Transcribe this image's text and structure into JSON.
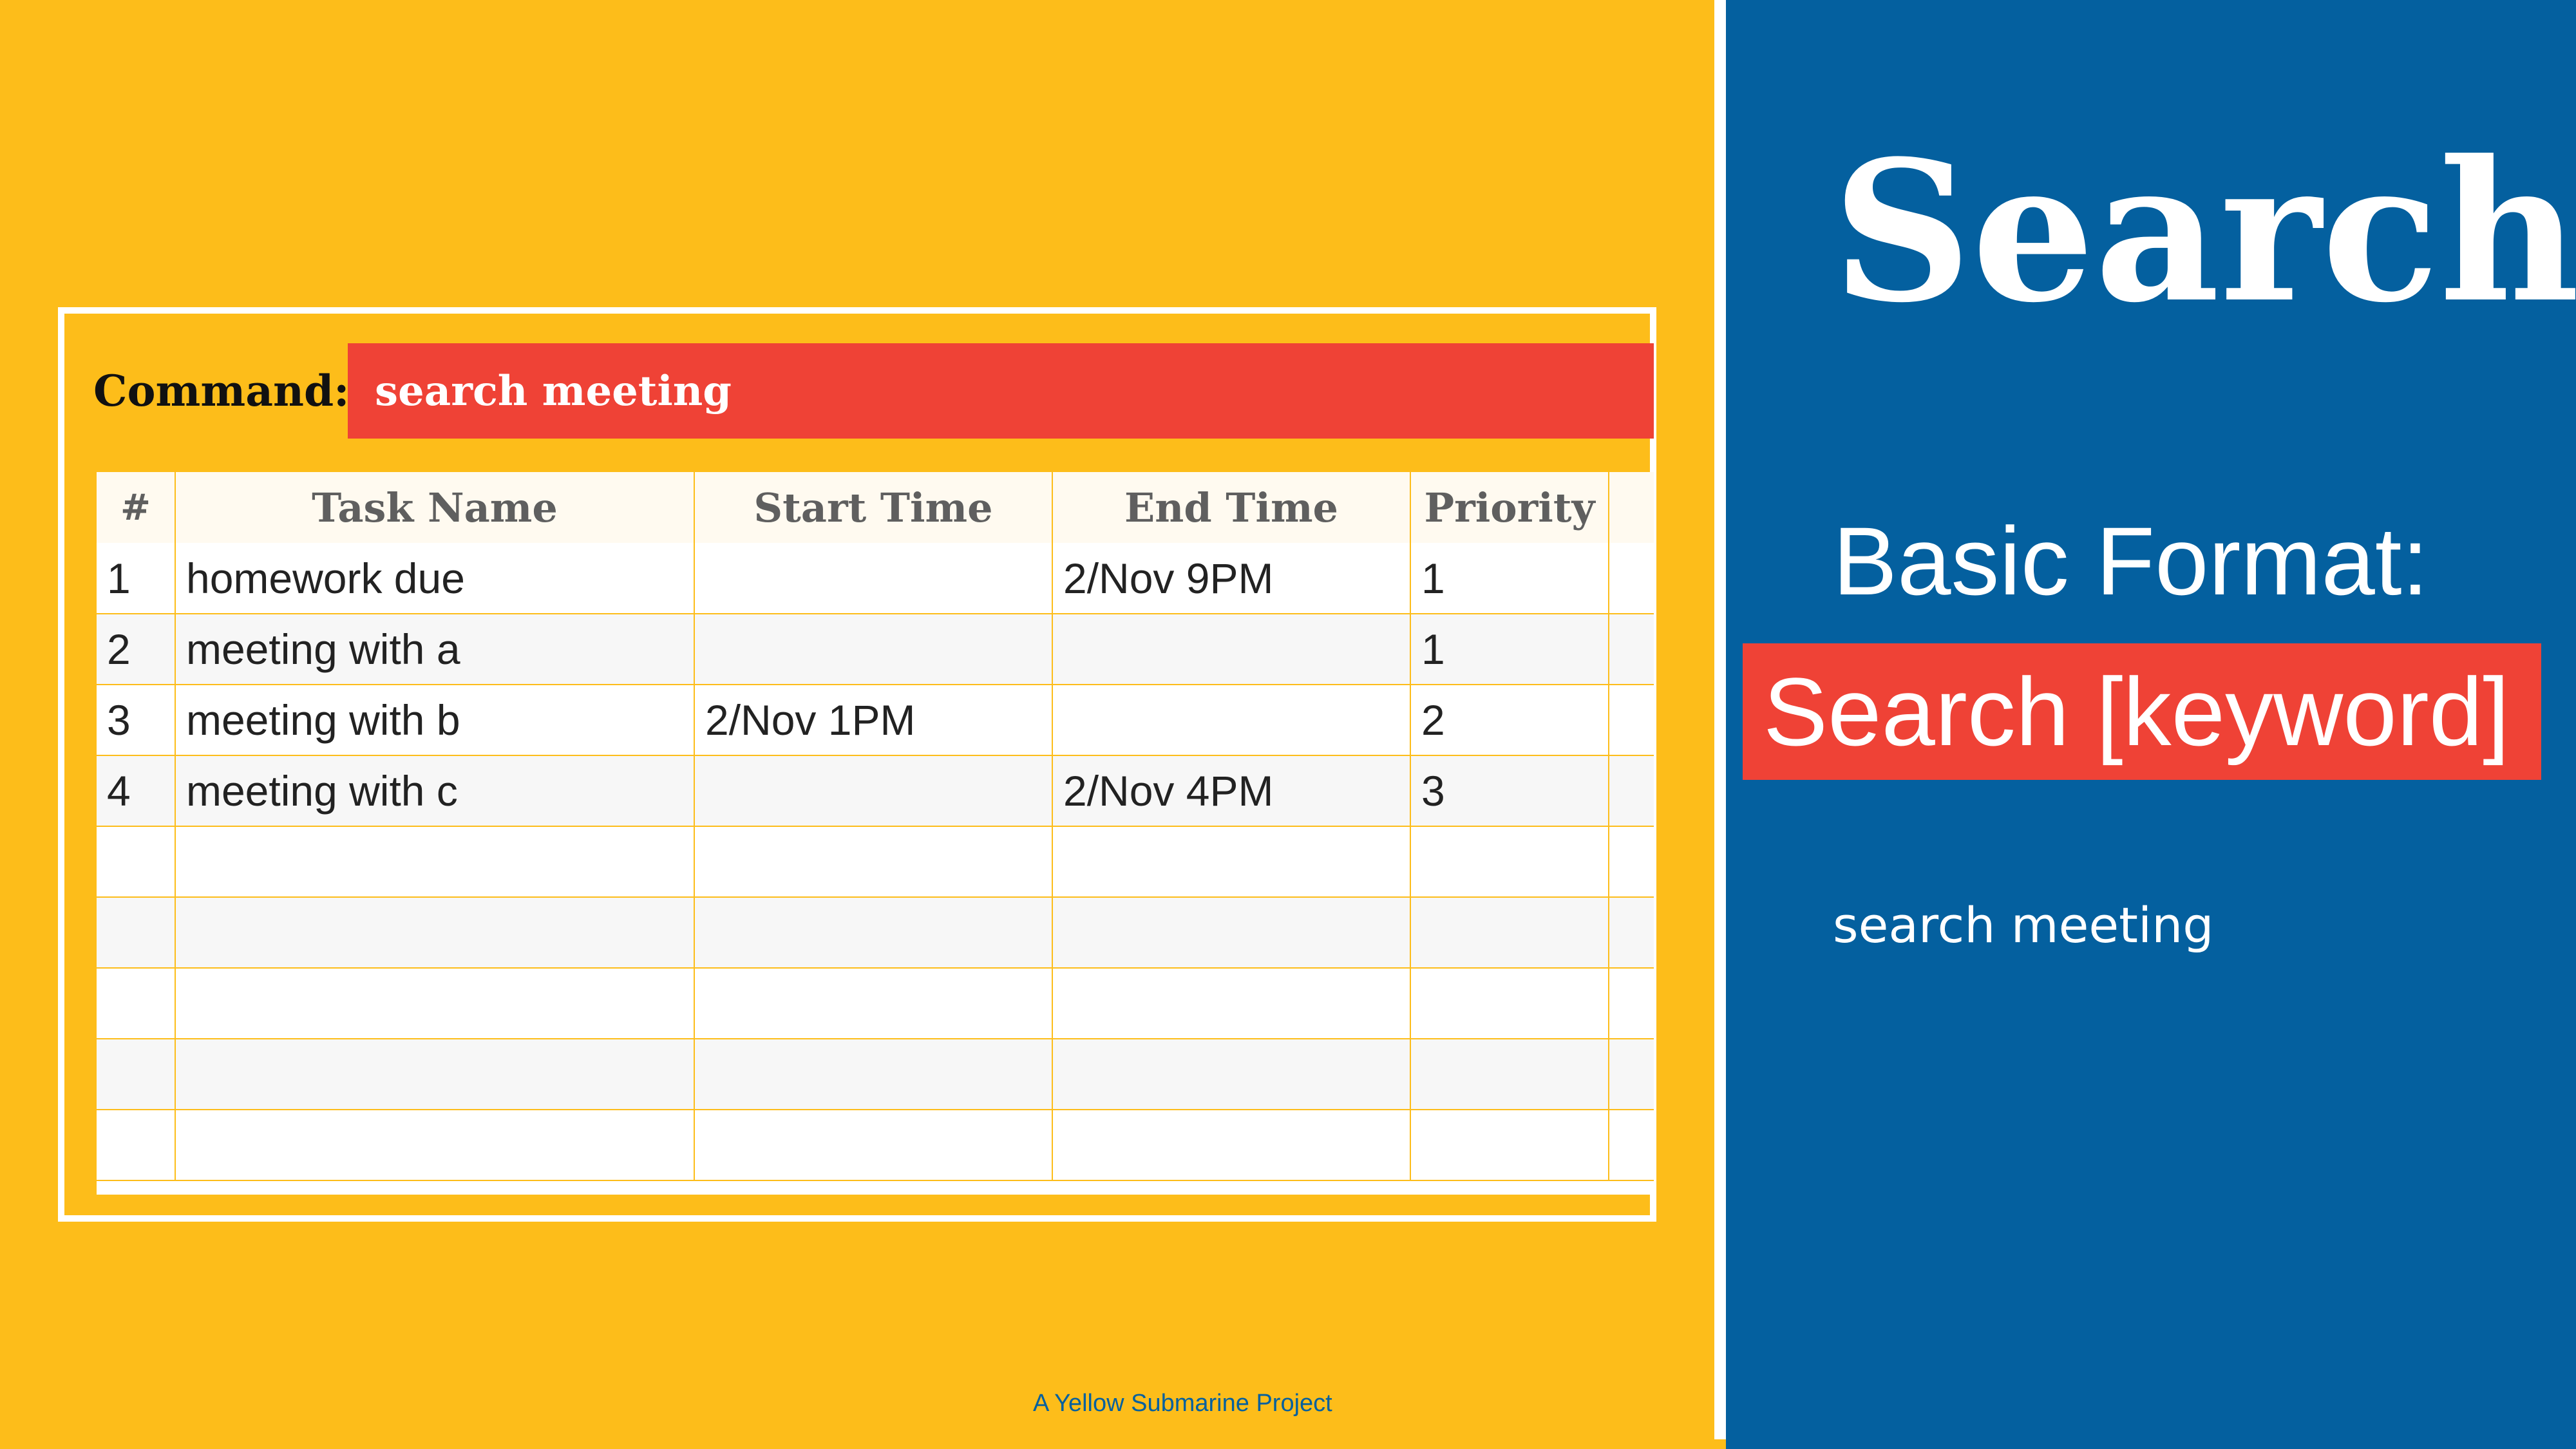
{
  "app": {
    "command_label": "Command:",
    "command_value": "search meeting",
    "table": {
      "headers": [
        "#",
        "Task Name",
        "Start Time",
        "End Time",
        "Priority"
      ],
      "rows": [
        {
          "num": "1",
          "name": "homework due",
          "start": "",
          "end": "2/Nov  9PM",
          "priority": "1"
        },
        {
          "num": "2",
          "name": "meeting with a",
          "start": "",
          "end": "",
          "priority": "1"
        },
        {
          "num": "3",
          "name": "meeting with b",
          "start": "2/Nov  1PM",
          "end": "",
          "priority": "2"
        },
        {
          "num": "4",
          "name": "meeting with c",
          "start": "",
          "end": "2/Nov  4PM",
          "priority": "3"
        }
      ]
    }
  },
  "footer": "A Yellow Submarine Project",
  "panel": {
    "title": "Search",
    "basic_format": "Basic Format:",
    "syntax": "Search [keyword]",
    "example": "search meeting"
  },
  "colors": {
    "yellow": "#fdbd1a",
    "blue": "#04609f",
    "red": "#ef4236"
  }
}
